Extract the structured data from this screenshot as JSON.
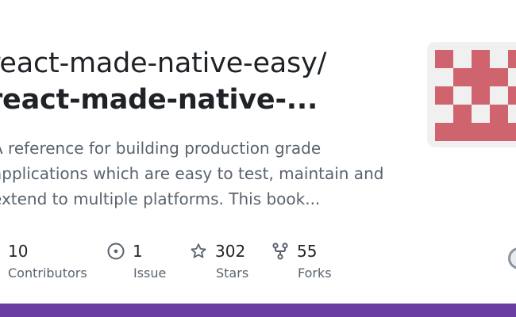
{
  "repo": {
    "owner_line": "react-made-native-easy/",
    "name_line": "react-made-native-...",
    "description_lines": [
      "A reference for building production grade",
      "applications which are easy to test, maintain and",
      "extend to multiple platforms. This book..."
    ]
  },
  "stats": [
    {
      "icon": "contributors-icon",
      "value": "10",
      "label": "Contributors"
    },
    {
      "icon": "issue-icon",
      "value": "1",
      "label": "Issue"
    },
    {
      "icon": "star-icon",
      "value": "302",
      "label": "Stars"
    },
    {
      "icon": "fork-icon",
      "value": "55",
      "label": "Forks"
    }
  ],
  "colors": {
    "identicon": "#d0646e",
    "identicon_bg": "#f0f0f0",
    "bottom_bar": "#6a3ea1",
    "text": "#1f2328",
    "muted": "#59636e"
  }
}
